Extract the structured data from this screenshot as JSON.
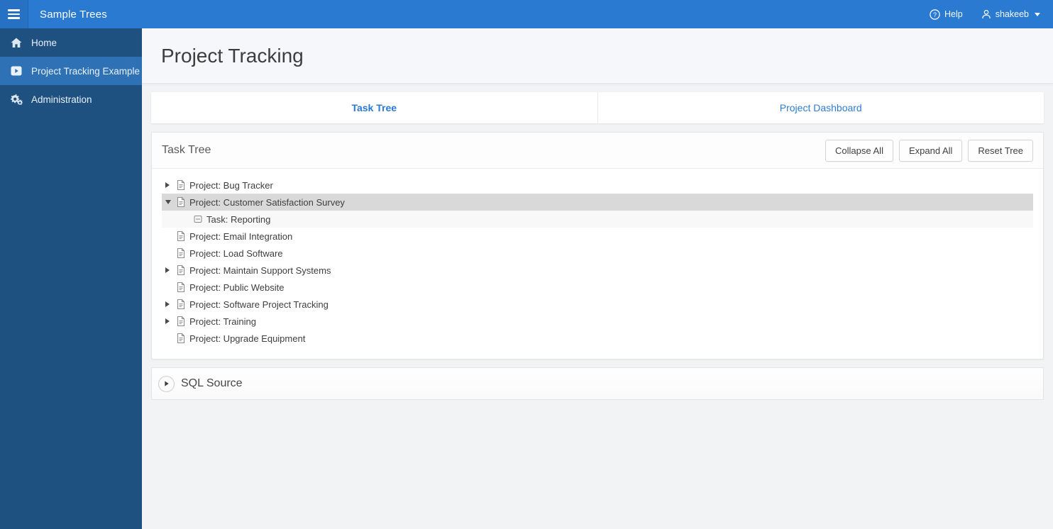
{
  "topbar": {
    "app_title": "Sample Trees",
    "help_label": "Help",
    "username": "shakeeb"
  },
  "sidebar": {
    "items": [
      {
        "label": "Home",
        "icon": "home-icon",
        "active": false
      },
      {
        "label": "Project Tracking Example",
        "icon": "play-square-icon",
        "active": true
      },
      {
        "label": "Administration",
        "icon": "gears-icon",
        "active": false
      }
    ]
  },
  "page": {
    "title": "Project Tracking"
  },
  "tabs": [
    {
      "label": "Task Tree",
      "active": true
    },
    {
      "label": "Project Dashboard",
      "active": false
    }
  ],
  "task_tree_region": {
    "title": "Task Tree",
    "buttons": [
      "Collapse All",
      "Expand All",
      "Reset Tree"
    ],
    "tree": [
      {
        "label": "Project: Bug Tracker",
        "level": 1,
        "arrow": "collapsed",
        "icon": "document",
        "state": "normal"
      },
      {
        "label": "Project: Customer Satisfaction Survey",
        "level": 1,
        "arrow": "expanded",
        "icon": "document",
        "state": "selected"
      },
      {
        "label": "Task: Reporting",
        "level": 2,
        "arrow": "none",
        "icon": "task",
        "state": "hovered"
      },
      {
        "label": "Project: Email Integration",
        "level": 1,
        "arrow": "none",
        "icon": "document",
        "state": "normal"
      },
      {
        "label": "Project: Load Software",
        "level": 1,
        "arrow": "none",
        "icon": "document",
        "state": "normal"
      },
      {
        "label": "Project: Maintain Support Systems",
        "level": 1,
        "arrow": "collapsed",
        "icon": "document",
        "state": "normal"
      },
      {
        "label": "Project: Public Website",
        "level": 1,
        "arrow": "none",
        "icon": "document",
        "state": "normal"
      },
      {
        "label": "Project: Software Project Tracking",
        "level": 1,
        "arrow": "collapsed",
        "icon": "document",
        "state": "normal"
      },
      {
        "label": "Project: Training",
        "level": 1,
        "arrow": "collapsed",
        "icon": "document",
        "state": "normal"
      },
      {
        "label": "Project: Upgrade Equipment",
        "level": 1,
        "arrow": "none",
        "icon": "document",
        "state": "normal"
      }
    ]
  },
  "sql_region": {
    "title": "SQL Source",
    "collapsed": true
  },
  "colors": {
    "topbar": "#2a7ad2",
    "sidebar": "#1f5180",
    "sidebar_active": "#2e72b5",
    "tab_link": "#2a7ad2",
    "selected_row": "#d9d9d9",
    "hovered_row": "#f8f8f8",
    "title_band": "#f5f7fa"
  }
}
